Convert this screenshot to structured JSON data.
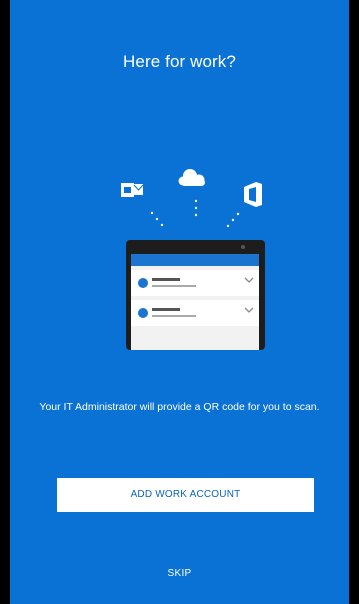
{
  "onboarding": {
    "title": "Here for work?",
    "description": "Your IT Administrator will provide a QR code for you to scan.",
    "add_work_account_label": "ADD WORK ACCOUNT",
    "skip_label": "SKIP",
    "illustration": {
      "icons": [
        "outlook-icon",
        "cloud-icon",
        "office-icon"
      ]
    }
  },
  "colors": {
    "background": "#0a72d4",
    "button_text": "#0a64bf",
    "tablet_frame": "#1d1d1d",
    "tablet_header": "#1a74d0"
  }
}
